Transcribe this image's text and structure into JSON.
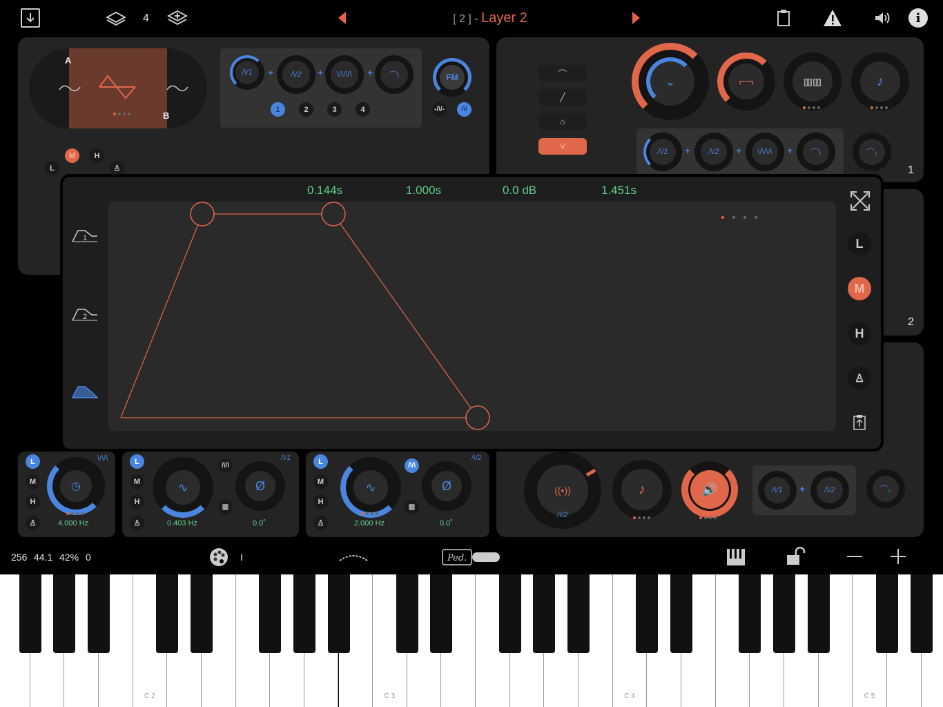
{
  "topbar": {
    "layer_count": "4",
    "title_prefix": "[ 2 ] - ",
    "title": "Layer 2"
  },
  "osc_section": {
    "label_a": "A",
    "label_b": "B",
    "mod_slots": [
      "1",
      "2",
      "3",
      "4"
    ],
    "fm_label": "FM",
    "quality_buttons": [
      "L",
      "M",
      "H"
    ]
  },
  "filter_section": {
    "panel_number": "1",
    "env_shapes": [
      "⌒",
      "╱",
      "⌂",
      "V"
    ]
  },
  "panel2": {
    "panel_number": "2"
  },
  "envelope_editor": {
    "attack": "0.144s",
    "hold": "1.000s",
    "sustain": "0.0 dB",
    "release": "1.451s",
    "env_tabs": [
      "1",
      "2",
      "3"
    ],
    "side_buttons": [
      "L",
      "M",
      "H"
    ]
  },
  "lfo1": {
    "buttons": [
      "L",
      "M",
      "H"
    ],
    "rate": "4.000 Hz"
  },
  "lfo2": {
    "buttons": [
      "L",
      "M",
      "H"
    ],
    "rate": "0.403 Hz",
    "phase": "0.0˚"
  },
  "lfo3": {
    "buttons": [
      "L",
      "M",
      "H"
    ],
    "rate": "2.000 Hz",
    "phase": "0.0˚"
  },
  "status_bar": {
    "buffer": "256",
    "sample_rate": "44.1",
    "cpu": "42%",
    "voices": "0",
    "cursor": "I"
  },
  "keyboard": {
    "labels": [
      "C 2",
      "C 3",
      "C 4",
      "C 5"
    ]
  },
  "colors": {
    "accent_orange": "#e0674a",
    "accent_blue": "#4a86e0",
    "value_green": "#5fcf8a"
  }
}
